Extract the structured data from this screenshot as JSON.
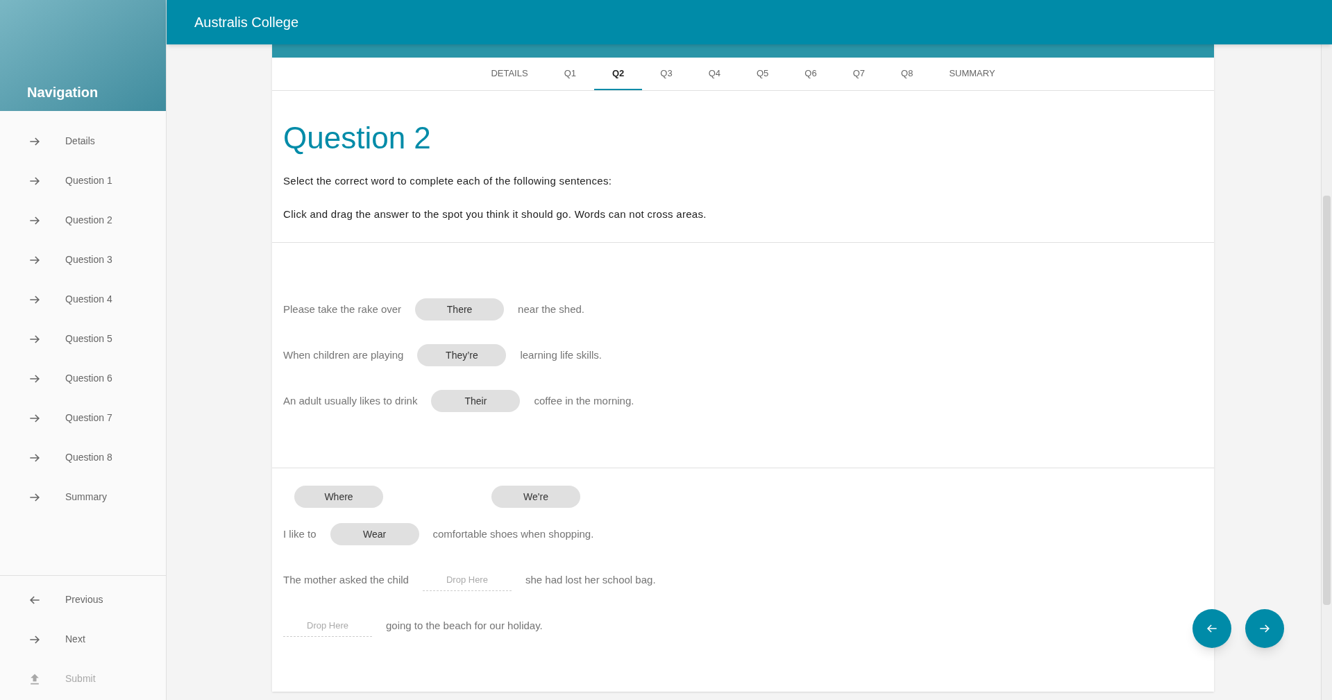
{
  "app_bar": {
    "title": "Australis College"
  },
  "sidebar": {
    "title": "Navigation",
    "items": [
      {
        "label": "Details",
        "kind": "forward",
        "disabled": false
      },
      {
        "label": "Question 1",
        "kind": "forward",
        "disabled": false
      },
      {
        "label": "Question 2",
        "kind": "forward",
        "disabled": false
      },
      {
        "label": "Question 3",
        "kind": "forward",
        "disabled": false
      },
      {
        "label": "Question 4",
        "kind": "forward",
        "disabled": false
      },
      {
        "label": "Question 5",
        "kind": "forward",
        "disabled": false
      },
      {
        "label": "Question 6",
        "kind": "forward",
        "disabled": false
      },
      {
        "label": "Question 7",
        "kind": "forward",
        "disabled": false
      },
      {
        "label": "Question 8",
        "kind": "forward",
        "disabled": false
      },
      {
        "label": "Summary",
        "kind": "forward",
        "disabled": false
      }
    ],
    "footer_items": [
      {
        "label": "Previous",
        "kind": "back",
        "disabled": false
      },
      {
        "label": "Next",
        "kind": "forward",
        "disabled": false
      },
      {
        "label": "Submit",
        "kind": "upload",
        "disabled": true
      }
    ]
  },
  "tabs": [
    {
      "label": "DETAILS",
      "selected": false
    },
    {
      "label": "Q1",
      "selected": false
    },
    {
      "label": "Q2",
      "selected": true
    },
    {
      "label": "Q3",
      "selected": false
    },
    {
      "label": "Q4",
      "selected": false
    },
    {
      "label": "Q5",
      "selected": false
    },
    {
      "label": "Q6",
      "selected": false
    },
    {
      "label": "Q7",
      "selected": false
    },
    {
      "label": "Q8",
      "selected": false
    },
    {
      "label": "SUMMARY",
      "selected": false
    }
  ],
  "question": {
    "title": "Question 2",
    "instructions": [
      "Select the correct word to complete each of the following sentences:",
      "Click and drag the answer to the spot you think it should go. Words can not cross areas."
    ]
  },
  "sections": [
    {
      "rows": [
        {
          "parts": [
            {
              "kind": "text",
              "text": "Please take the rake over"
            },
            {
              "kind": "word",
              "text": "There"
            },
            {
              "kind": "text",
              "text": "near the shed."
            }
          ]
        },
        {
          "parts": [
            {
              "kind": "text",
              "text": "When children are playing"
            },
            {
              "kind": "word",
              "text": "They’re"
            },
            {
              "kind": "text",
              "text": "learning life skills."
            }
          ]
        },
        {
          "parts": [
            {
              "kind": "text",
              "text": "An adult usually likes to drink"
            },
            {
              "kind": "word",
              "text": "Their"
            },
            {
              "kind": "text",
              "text": "coffee in the morning."
            }
          ]
        }
      ]
    },
    {
      "word_bank": [
        "Where",
        "We're"
      ],
      "rows": [
        {
          "parts": [
            {
              "kind": "text",
              "text": "I like to"
            },
            {
              "kind": "word",
              "text": "Wear"
            },
            {
              "kind": "text",
              "text": "comfortable shoes when shopping."
            }
          ]
        },
        {
          "parts": [
            {
              "kind": "text",
              "text": "The mother asked the child"
            },
            {
              "kind": "drop",
              "text": "Drop Here"
            },
            {
              "kind": "text",
              "text": "she had lost her school bag."
            }
          ]
        },
        {
          "parts": [
            {
              "kind": "drop",
              "text": "Drop Here"
            },
            {
              "kind": "text",
              "text": "going to the beach for our holiday."
            }
          ]
        }
      ]
    }
  ]
}
